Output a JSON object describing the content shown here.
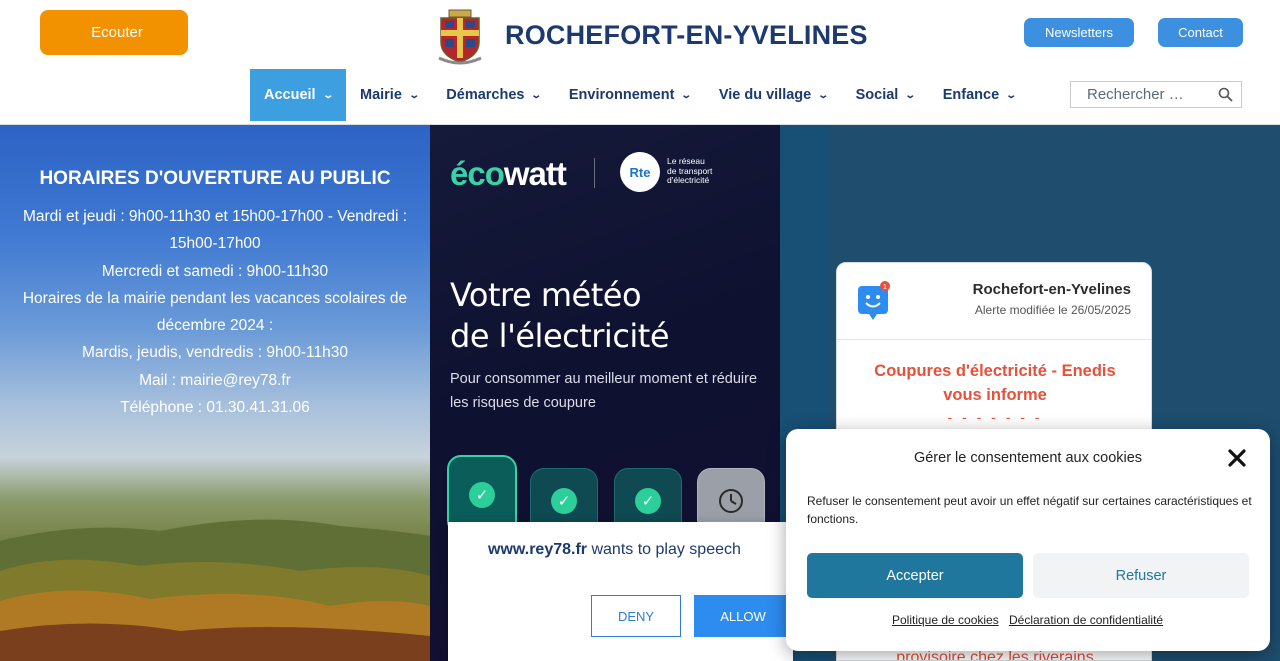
{
  "header": {
    "listen_label": "Ecouter",
    "listen_glyph": "",
    "site_title": "ROCHEFORT-EN-YVELINES",
    "newsletters_label": "Newsletters",
    "contact_label": "Contact",
    "search_placeholder": "Rechercher …"
  },
  "nav": {
    "items": [
      {
        "label": "Accueil"
      },
      {
        "label": "Mairie"
      },
      {
        "label": "Démarches"
      },
      {
        "label": "Environnement"
      },
      {
        "label": "Vie du village"
      },
      {
        "label": "Social"
      },
      {
        "label": "Enfance"
      }
    ]
  },
  "hours": {
    "title": "HORAIRES D'OUVERTURE AU PUBLIC",
    "lines": [
      "Mardi et jeudi : 9h00-11h30 et 15h00-17h00 - Vendredi : 15h00-17h00",
      "Mercredi et samedi : 9h00-11h30",
      "Horaires de la mairie pendant les vacances scolaires de décembre 2024 :",
      "Mardis, jeudis, vendredis : 9h00-11h30",
      "Mail : mairie@rey78.fr",
      "Téléphone : 01.30.41.31.06"
    ]
  },
  "ecowatt": {
    "logo_part1": "éco",
    "logo_part2": "watt",
    "rte_badge": "Rte",
    "rte_text_1": "Le réseau",
    "rte_text_2": "de transport",
    "rte_text_3": "d'électricité",
    "heading_line1": "Votre météo",
    "heading_line2": "de l'électricité",
    "subtitle": "Pour consommer au meilleur moment et réduire les risques de coupure"
  },
  "alert": {
    "badge_count": "1",
    "town": "Rochefort-en-Yvelines",
    "date": "Alerte modifiée le 26/05/2025",
    "title": "Coupures d'électricité - Enedis vous informe",
    "dashes": "- - - - - - -",
    "more_text": "provisoire chez les riverains"
  },
  "speech_prompt": {
    "domain": "www.rey78.fr",
    "message": " wants to play speech",
    "deny_label": "DENY",
    "allow_label": "ALLOW"
  },
  "cookie": {
    "title": "Gérer le consentement aux cookies",
    "text": "Refuser le consentement peut avoir un effet négatif sur certaines caractéristiques et fonctions.",
    "accept_label": "Accepter",
    "refuse_label": "Refuser",
    "policy_link": "Politique de cookies",
    "privacy_link": "Déclaration de confidentialité"
  },
  "colors": {
    "brand_blue": "#1c3a6e",
    "accent_orange": "#f39200",
    "nav_active": "#3d9ee0",
    "button_blue": "#3d8fe0",
    "alert_red": "#e8503a",
    "cookie_accept": "#20779e"
  }
}
